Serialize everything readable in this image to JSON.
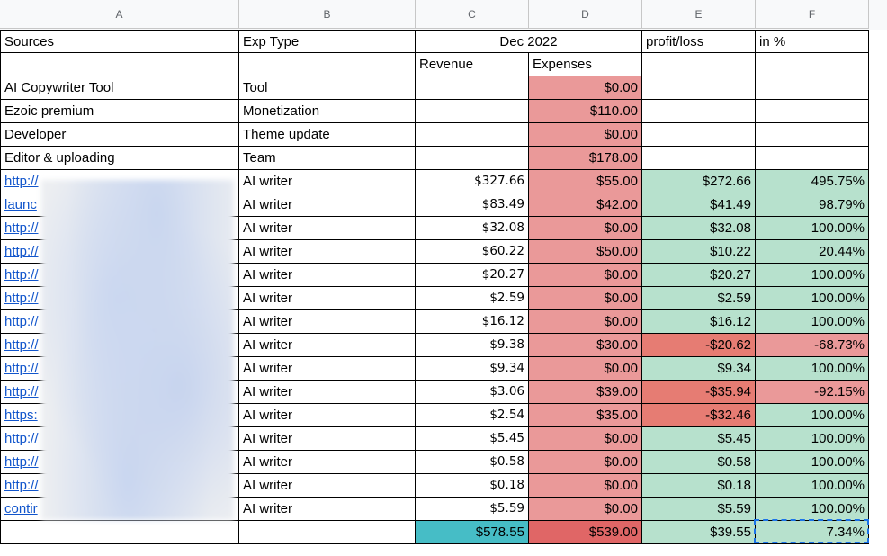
{
  "column_headers": [
    "A",
    "B",
    "C",
    "D",
    "E",
    "F"
  ],
  "header_row1": {
    "sources": "Sources",
    "exp_type": "Exp Type",
    "period": "Dec 2022",
    "profit_loss": "profit/loss",
    "in_pct": "in %"
  },
  "header_row2": {
    "revenue": "Revenue",
    "expenses": "Expenses"
  },
  "rows": [
    {
      "source": "AI Copywriter Tool",
      "type": "Tool",
      "revenue": "",
      "expenses": "$0.00",
      "profit": "",
      "pct": "",
      "link": false
    },
    {
      "source": "Ezoic premium",
      "type": "Monetization",
      "revenue": "",
      "expenses": "$110.00",
      "profit": "",
      "pct": "",
      "link": false
    },
    {
      "source": "Developer",
      "type": "Theme update",
      "revenue": "",
      "expenses": "$0.00",
      "profit": "",
      "pct": "",
      "link": false
    },
    {
      "source": "Editor & uploading",
      "type": "Team",
      "revenue": "",
      "expenses": "$178.00",
      "profit": "",
      "pct": "",
      "link": false
    },
    {
      "source": "http://",
      "type": "AI writer",
      "revenue": "$327.66",
      "expenses": "$55.00",
      "profit": "$272.66",
      "pct": "495.75%",
      "link": true,
      "ptone": "green",
      "pctone": "green"
    },
    {
      "source": "launc",
      "type": "AI writer",
      "revenue": "$83.49",
      "expenses": "$42.00",
      "profit": "$41.49",
      "pct": "98.79%",
      "link": true,
      "ptone": "green",
      "pctone": "green"
    },
    {
      "source": "http://",
      "type": "AI writer",
      "revenue": "$32.08",
      "expenses": "$0.00",
      "profit": "$32.08",
      "pct": "100.00%",
      "link": true,
      "ptone": "green",
      "pctone": "green"
    },
    {
      "source": "http://",
      "type": "AI writer",
      "revenue": "$60.22",
      "expenses": "$50.00",
      "profit": "$10.22",
      "pct": "20.44%",
      "link": true,
      "ptone": "green",
      "pctone": "green"
    },
    {
      "source": "http://",
      "type": "AI writer",
      "revenue": "$20.27",
      "expenses": "$0.00",
      "profit": "$20.27",
      "pct": "100.00%",
      "link": true,
      "ptone": "green",
      "pctone": "green"
    },
    {
      "source": "http://",
      "type": "AI writer",
      "revenue": "$2.59",
      "expenses": "$0.00",
      "profit": "$2.59",
      "pct": "100.00%",
      "link": true,
      "ptone": "green",
      "pctone": "green"
    },
    {
      "source": "http://",
      "type": "AI writer",
      "revenue": "$16.12",
      "expenses": "$0.00",
      "profit": "$16.12",
      "pct": "100.00%",
      "link": true,
      "ptone": "green",
      "pctone": "green"
    },
    {
      "source": "http://",
      "type": "AI writer",
      "revenue": "$9.38",
      "expenses": "$30.00",
      "profit": "-$20.62",
      "pct": "-68.73%",
      "link": true,
      "ptone": "orange",
      "pctone": "red"
    },
    {
      "source": "http://",
      "type": "AI writer",
      "revenue": "$9.34",
      "expenses": "$0.00",
      "profit": "$9.34",
      "pct": "100.00%",
      "link": true,
      "ptone": "green",
      "pctone": "green"
    },
    {
      "source": "http://",
      "type": "AI writer",
      "revenue": "$3.06",
      "expenses": "$39.00",
      "profit": "-$35.94",
      "pct": "-92.15%",
      "link": true,
      "ptone": "orange",
      "pctone": "red"
    },
    {
      "source": "https:",
      "type": "AI writer",
      "revenue": "$2.54",
      "expenses": "$35.00",
      "profit": "-$32.46",
      "pct": "100.00%",
      "link": true,
      "ptone": "orange",
      "pctone": "green"
    },
    {
      "source": "http://",
      "type": "AI writer",
      "revenue": "$5.45",
      "expenses": "$0.00",
      "profit": "$5.45",
      "pct": "100.00%",
      "link": true,
      "ptone": "green",
      "pctone": "green"
    },
    {
      "source": "http://",
      "type": "AI writer",
      "revenue": "$0.58",
      "expenses": "$0.00",
      "profit": "$0.58",
      "pct": "100.00%",
      "link": true,
      "ptone": "green",
      "pctone": "green"
    },
    {
      "source": "http://",
      "type": "AI writer",
      "revenue": "$0.18",
      "expenses": "$0.00",
      "profit": "$0.18",
      "pct": "100.00%",
      "link": true,
      "ptone": "green",
      "pctone": "green"
    },
    {
      "source": "contir",
      "type": "AI writer",
      "revenue": "$5.59",
      "expenses": "$0.00",
      "profit": "$5.59",
      "pct": "100.00%",
      "link": true,
      "ptone": "green",
      "pctone": "green"
    }
  ],
  "totals": {
    "revenue": "$578.55",
    "expenses": "$539.00",
    "profit": "$39.55",
    "pct": "7.34%"
  },
  "colors": {
    "expense_bg": "#ea9999",
    "total_expense_bg": "#e06666",
    "loss_bg": "#e67c73",
    "gain_bg": "#b7e1cd",
    "total_revenue_bg": "#46bdc6",
    "link": "#1155cc",
    "selection": "#1a73e8"
  }
}
